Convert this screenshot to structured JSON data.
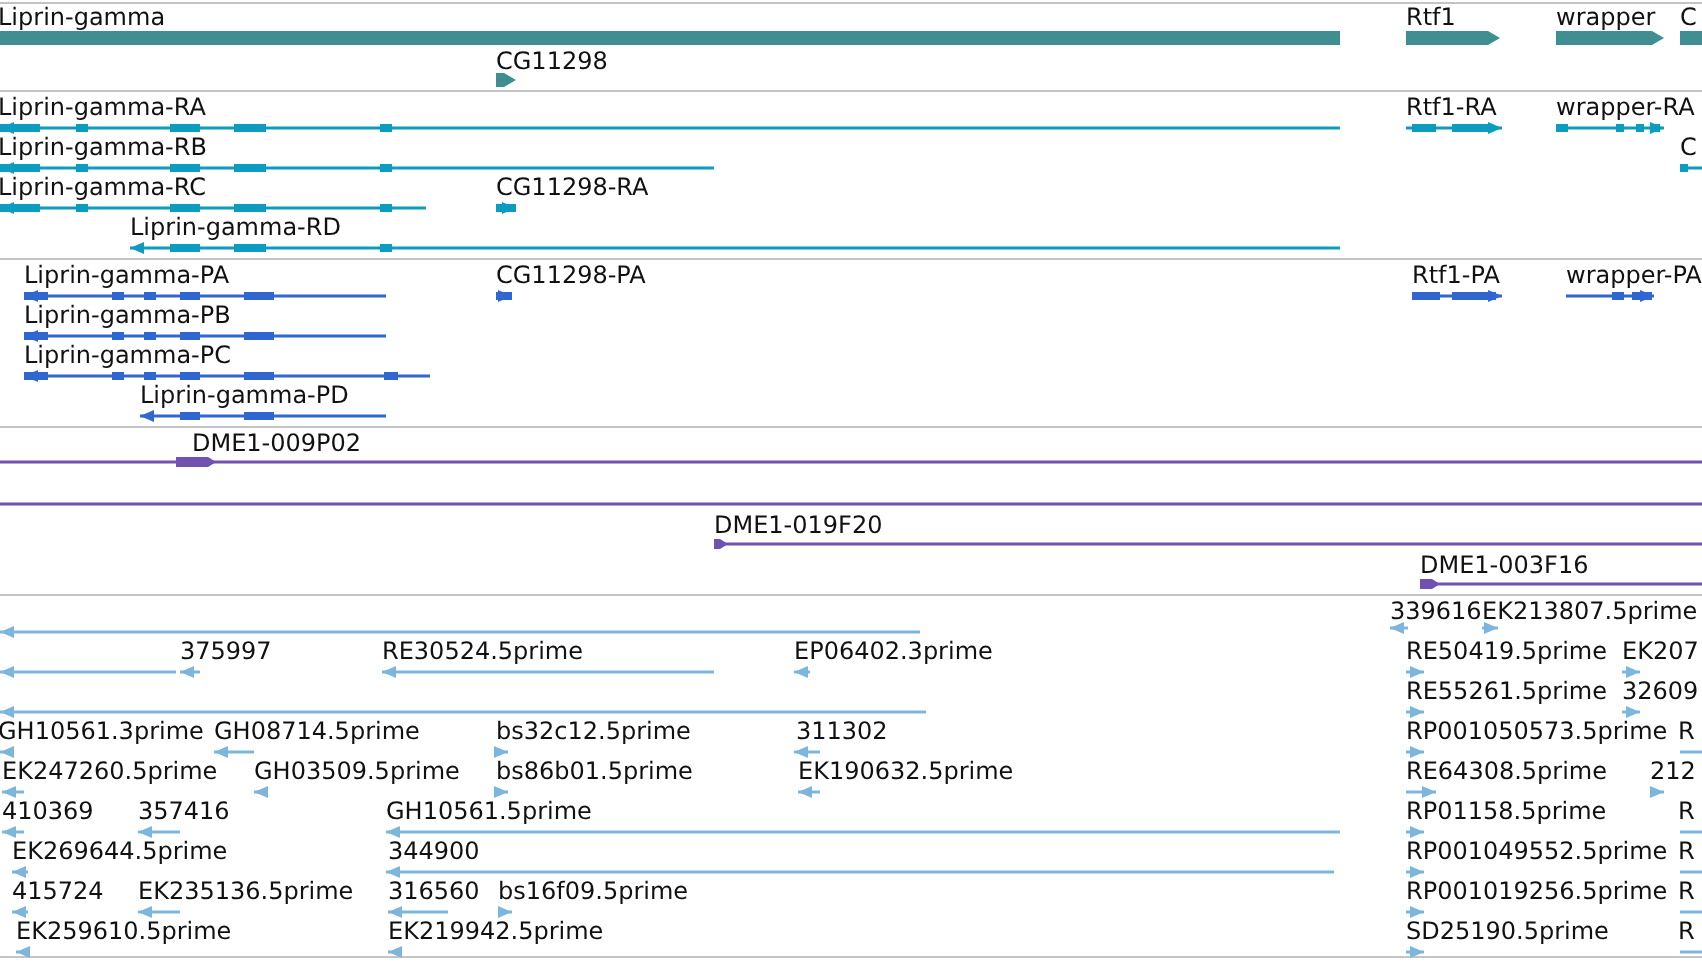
{
  "tracks": [
    {
      "kind": "gene",
      "features": [
        {
          "label": "Liprin-gamma",
          "reverse": true
        },
        {
          "label": "CG11298",
          "reverse": false
        },
        {
          "label": "Rtf1",
          "reverse": false
        },
        {
          "label": "wrapper",
          "reverse": false
        },
        {
          "label": "C",
          "reverse": false
        }
      ]
    },
    {
      "kind": "transcript",
      "features": [
        {
          "label": "Liprin-gamma-RA",
          "reverse": true
        },
        {
          "label": "Liprin-gamma-RB",
          "reverse": true
        },
        {
          "label": "Liprin-gamma-RC",
          "reverse": true
        },
        {
          "label": "Liprin-gamma-RD",
          "reverse": true
        },
        {
          "label": "CG11298-RA",
          "reverse": false
        },
        {
          "label": "Rtf1-RA",
          "reverse": false
        },
        {
          "label": "wrapper-RA",
          "reverse": false
        },
        {
          "label": "C",
          "reverse": false
        }
      ]
    },
    {
      "kind": "protein",
      "features": [
        {
          "label": "Liprin-gamma-PA",
          "reverse": true
        },
        {
          "label": "Liprin-gamma-PB",
          "reverse": true
        },
        {
          "label": "Liprin-gamma-PC",
          "reverse": true
        },
        {
          "label": "Liprin-gamma-PD",
          "reverse": true
        },
        {
          "label": "CG11298-PA",
          "reverse": false
        },
        {
          "label": "Rtf1-PA",
          "reverse": false
        },
        {
          "label": "wrapper-PA",
          "reverse": false
        }
      ]
    },
    {
      "kind": "clone",
      "features": [
        {
          "kind": "clone",
          "label": "DME1-009P02",
          "reverse": false
        },
        {
          "kind": "line"
        },
        {
          "kind": "clone",
          "label": "DME1-019F20",
          "reverse": false
        },
        {
          "kind": "clone",
          "label": "DME1-003F16",
          "reverse": false
        }
      ]
    },
    {
      "kind": "est",
      "features": [
        {
          "reverse": true
        },
        {
          "label": "339616",
          "reverse": true
        },
        {
          "label": "EK213807.5prime",
          "reverse": false
        },
        {
          "reverse": true
        },
        {
          "label": "375997",
          "reverse": true
        },
        {
          "label": "RE30524.5prime",
          "reverse": true
        },
        {
          "label": "EP06402.3prime",
          "reverse": true
        },
        {
          "label": "RE50419.5prime",
          "reverse": false
        },
        {
          "label": "EK207",
          "reverse": false
        },
        {
          "reverse": true
        },
        {
          "label": "RE55261.5prime",
          "reverse": false
        },
        {
          "label": "32609",
          "reverse": false
        },
        {
          "label": "GH10561.3prime",
          "reverse": true
        },
        {
          "label": "GH08714.5prime",
          "reverse": true
        },
        {
          "label": "bs32c12.5prime",
          "reverse": false
        },
        {
          "label": "311302",
          "reverse": true
        },
        {
          "label": "RP001050573.5prime",
          "reverse": false
        },
        {
          "label": "R",
          "reverse": false
        },
        {
          "label": "EK247260.5prime",
          "reverse": true
        },
        {
          "label": "GH03509.5prime",
          "reverse": true
        },
        {
          "label": "bs86b01.5prime",
          "reverse": false
        },
        {
          "label": "EK190632.5prime",
          "reverse": true
        },
        {
          "label": "RE64308.5prime",
          "reverse": false
        },
        {
          "label": "212",
          "reverse": false
        },
        {
          "label": "410369",
          "reverse": true
        },
        {
          "label": "357416",
          "reverse": true
        },
        {
          "label": "GH10561.5prime",
          "reverse": true
        },
        {
          "label": "RP01158.5prime",
          "reverse": false
        },
        {
          "label": "R",
          "reverse": false
        },
        {
          "label": "EK269644.5prime",
          "reverse": true
        },
        {
          "label": "344900",
          "reverse": true
        },
        {
          "label": "RP001049552.5prime",
          "reverse": false
        },
        {
          "label": "R",
          "reverse": false
        },
        {
          "label": "415724",
          "reverse": true
        },
        {
          "label": "EK235136.5prime",
          "reverse": true
        },
        {
          "label": "316560",
          "reverse": true
        },
        {
          "label": "bs16f09.5prime",
          "reverse": false
        },
        {
          "label": "RP001019256.5prime",
          "reverse": false
        },
        {
          "label": "R",
          "reverse": false
        },
        {
          "label": "EK259610.5prime",
          "reverse": true
        },
        {
          "label": "EK219942.5prime",
          "reverse": true
        },
        {
          "label": "SD25190.5prime",
          "reverse": false
        },
        {
          "label": "R",
          "reverse": false
        }
      ]
    }
  ]
}
